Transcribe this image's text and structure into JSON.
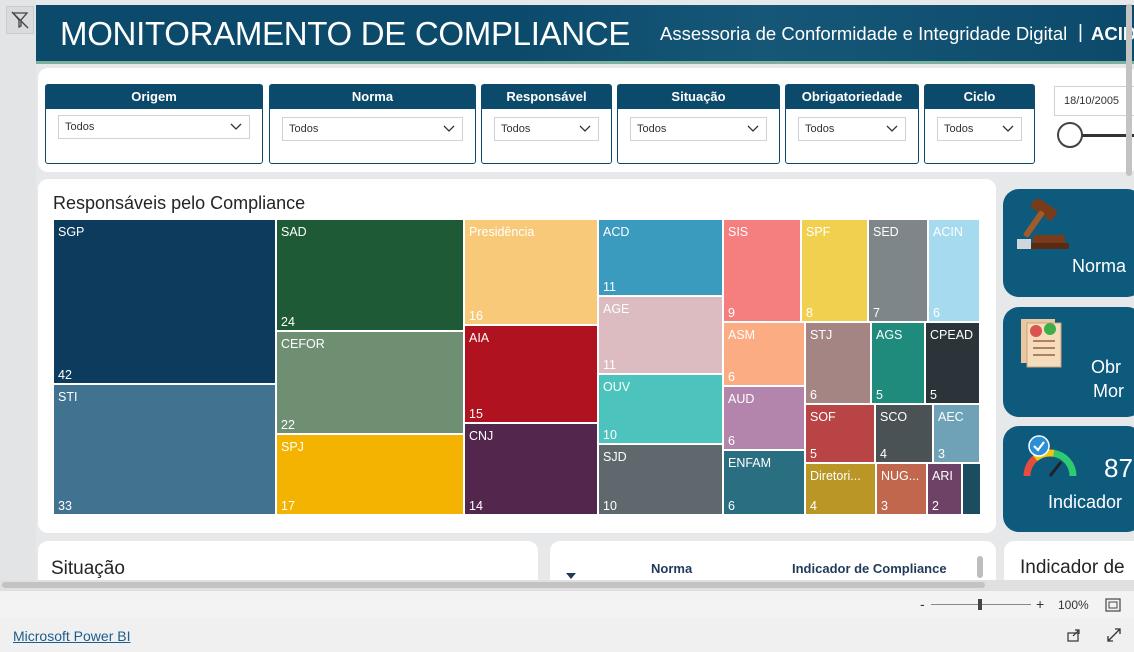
{
  "header": {
    "title": "MONITORAMENTO DE COMPLIANCE",
    "subtitle": "Assessoria de Conformidade e Integridade Digital",
    "separator": "|",
    "acronym": "ACID"
  },
  "filters": [
    {
      "label": "Origem",
      "value": "Todos"
    },
    {
      "label": "Norma",
      "value": "Todos"
    },
    {
      "label": "Responsável",
      "value": "Todos"
    },
    {
      "label": "Situação",
      "value": "Todos"
    },
    {
      "label": "Obrigatoriedade",
      "value": "Todos"
    },
    {
      "label": "Ciclo",
      "value": "Todos"
    }
  ],
  "date_filter": {
    "value": "18/10/2005"
  },
  "treemap": {
    "title": "Responsáveis pelo Compliance",
    "cells": [
      {
        "label": "SGP",
        "value": 42,
        "color": "#0d3b5e",
        "text": "#ffffff"
      },
      {
        "label": "STI",
        "value": 33,
        "color": "#41728f",
        "text": "#ffffff"
      },
      {
        "label": "SAD",
        "value": 24,
        "color": "#1f5a36",
        "text": "#ffffff"
      },
      {
        "label": "CEFOR",
        "value": 22,
        "color": "#6f8f73",
        "text": "#ffffff"
      },
      {
        "label": "SPJ",
        "value": 17,
        "color": "#f4b300",
        "text": "#ffffff"
      },
      {
        "label": "Presidência",
        "value": 16,
        "color": "#f9c97a",
        "text": "#ffffff"
      },
      {
        "label": "AIA",
        "value": 15,
        "color": "#b0131f",
        "text": "#ffffff"
      },
      {
        "label": "CNJ",
        "value": 14,
        "color": "#53264e",
        "text": "#ffffff"
      },
      {
        "label": "ACD",
        "value": 11,
        "color": "#3a9bbf",
        "text": "#ffffff"
      },
      {
        "label": "AGE",
        "value": 11,
        "color": "#dcbcc0",
        "text": "#ffffff"
      },
      {
        "label": "OUV",
        "value": 10,
        "color": "#4cc4bd",
        "text": "#ffffff"
      },
      {
        "label": "SJD",
        "value": 10,
        "color": "#5f696d",
        "text": "#ffffff"
      },
      {
        "label": "SIS",
        "value": 9,
        "color": "#f47f7e",
        "text": "#ffffff"
      },
      {
        "label": "SPF",
        "value": 8,
        "color": "#f2d04f",
        "text": "#ffffff"
      },
      {
        "label": "SED",
        "value": 7,
        "color": "#7f8689",
        "text": "#ffffff"
      },
      {
        "label": "ACIN",
        "value": 6,
        "color": "#a6dbef",
        "text": "#ffffff"
      },
      {
        "label": "ASM",
        "value": 6,
        "color": "#fbac82",
        "text": "#ffffff"
      },
      {
        "label": "STJ",
        "value": 6,
        "color": "#a48584",
        "text": "#ffffff"
      },
      {
        "label": "AGS",
        "value": 5,
        "color": "#1f8b7c",
        "text": "#ffffff"
      },
      {
        "label": "CPEAD",
        "value": 5,
        "color": "#2b3539",
        "text": "#ffffff"
      },
      {
        "label": "AUD",
        "value": 6,
        "color": "#b485ac",
        "text": "#ffffff"
      },
      {
        "label": "SOF",
        "value": 5,
        "color": "#b84446",
        "text": "#ffffff"
      },
      {
        "label": "SCO",
        "value": 4,
        "color": "#4a5255",
        "text": "#ffffff"
      },
      {
        "label": "AEC",
        "value": 3,
        "color": "#6fa2b6",
        "text": "#ffffff"
      },
      {
        "label": "ENFAM",
        "value": 6,
        "color": "#2a6e82",
        "text": "#ffffff"
      },
      {
        "label": "Diretori...",
        "value": 4,
        "color": "#b99626",
        "text": "#ffffff"
      },
      {
        "label": "NUG...",
        "value": 3,
        "color": "#c0674e",
        "text": "#ffffff"
      },
      {
        "label": "ARI",
        "value": 2,
        "color": "#6e4267",
        "text": "#ffffff"
      },
      {
        "label": "",
        "value": null,
        "color": "#1c4d5e",
        "text": "#ffffff"
      }
    ]
  },
  "kpi_cards": [
    {
      "label": "Norma"
    },
    {
      "label_line1": "Obr",
      "label_line2": "Mor"
    },
    {
      "number": "87",
      "label": "Indicador"
    }
  ],
  "bottom": {
    "situacao_title": "Situação",
    "table_headers": [
      "Norma",
      "Indicador de Compliance"
    ],
    "indicador_title": "Indicador de"
  },
  "zoom": {
    "minus": "-",
    "plus": "+",
    "level": "100%"
  },
  "footer": {
    "link": "Microsoft Power BI"
  },
  "colors": {
    "primary": "#0c4a6b",
    "kpi": "#0d5a7d",
    "accent_green": "#3a8a6a"
  }
}
